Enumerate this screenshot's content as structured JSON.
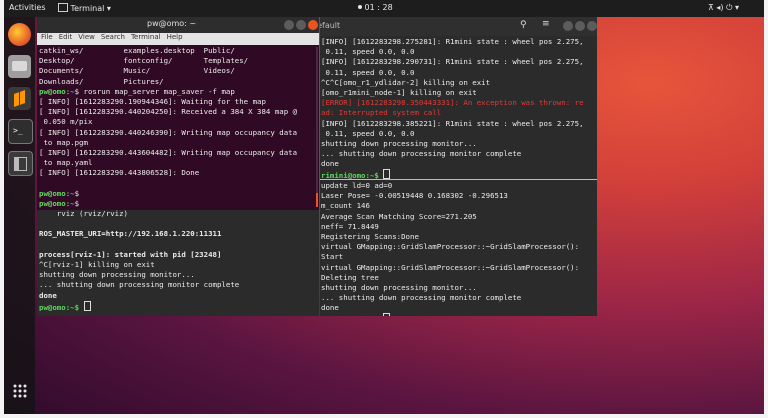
{
  "topbar": {
    "activities": "Activities",
    "app": "Terminal",
    "time": "01 : 28"
  },
  "window_left": {
    "title": "pw@omo: ~",
    "menu": [
      "File",
      "Edit",
      "View",
      "Search",
      "Terminal",
      "Help"
    ],
    "lines": [
      {
        "t": "catkin_ws/         examples.desktop  Public/",
        "c": "w"
      },
      {
        "t": "Desktop/           fontconfig/       Templates/",
        "c": "w"
      },
      {
        "t": "Documents/         Music/            Videos/",
        "c": "w"
      },
      {
        "t": "Downloads/         Pictures/",
        "c": "w"
      },
      {
        "t": "pw@omo:~$ rosrun map_server map_saver -f map",
        "c": "w"
      },
      {
        "t": "[ INFO] [1612283290.190944346]: Waiting for the map",
        "c": "w"
      },
      {
        "t": "[ INFO] [1612283290.440204250]: Received a 384 X 384 map @",
        "c": "w"
      },
      {
        "t": " 0.050 m/pix",
        "c": "w"
      },
      {
        "t": "[ INFO] [1612283290.440246390]: Writing map occupancy data",
        "c": "w"
      },
      {
        "t": " to map.pgm",
        "c": "w"
      },
      {
        "t": "[ INFO] [1612283290.443604482]: Writing map occupancy data",
        "c": "w"
      },
      {
        "t": " to map.yaml",
        "c": "w"
      },
      {
        "t": "[ INFO] [1612283290.443806528]: Done",
        "c": "w"
      },
      {
        "t": "",
        "c": "w"
      },
      {
        "t": "pw@omo:~$",
        "c": "w"
      },
      {
        "t": "pw@omo:~$",
        "c": "w"
      },
      {
        "t": "pw@omo:~$",
        "c": "w"
      },
      {
        "t": "pw@omo:~$",
        "c": "w"
      }
    ],
    "prompt_user": "pw@omo"
  },
  "window_bottom_left": {
    "lines": [
      {
        "t": "    rviz (rviz/rviz)",
        "c": "w",
        "bold": false
      },
      {
        "t": "",
        "c": "w",
        "bold": false
      },
      {
        "t": "ROS_MASTER_URI=http://192.168.1.220:11311",
        "c": "w",
        "bold": true
      },
      {
        "t": "",
        "c": "w",
        "bold": false
      },
      {
        "t": "process[rviz-1]: started with pid [23248]",
        "c": "w",
        "bold": true
      },
      {
        "t": "^C[rviz-1] killing on exit",
        "c": "w",
        "bold": false
      },
      {
        "t": "shutting down processing monitor...",
        "c": "w",
        "bold": false
      },
      {
        "t": "... shutting down processing monitor complete",
        "c": "w",
        "bold": false
      },
      {
        "t": "done",
        "c": "w",
        "bold": true
      },
      {
        "t": "pw@omo:~$ ",
        "c": "g",
        "bold": true
      }
    ]
  },
  "window_right": {
    "title": "default",
    "top_lines": [
      {
        "t": "[INFO] [1612283298.275281]: R1mini state : wheel pos 2.275,",
        "c": "w"
      },
      {
        "t": " 0.11, speed 0.0, 0.0",
        "c": "w"
      },
      {
        "t": "[INFO] [1612283298.290731]: R1mini state : wheel pos 2.275,",
        "c": "w"
      },
      {
        "t": " 0.11, speed 0.0, 0.0",
        "c": "w"
      },
      {
        "t": "^C^C[omo_r1_ydlidar-2] killing on exit",
        "c": "w"
      },
      {
        "t": "[omo_r1mini_node-1] killing on exit",
        "c": "w"
      },
      {
        "t": "[ERROR] [1612283298.350443331]: An exception was thrown: re",
        "c": "r"
      },
      {
        "t": "ad: Interrupted system call",
        "c": "r"
      },
      {
        "t": "[INFO] [1612283298.385221]: R1mini state : wheel pos 2.275,",
        "c": "w"
      },
      {
        "t": " 0.11, speed 0.0, 0.0",
        "c": "w"
      },
      {
        "t": "shutting down processing monitor...",
        "c": "w"
      },
      {
        "t": "... shutting down processing monitor complete",
        "c": "w"
      },
      {
        "t": "done",
        "c": "w"
      },
      {
        "t": "rimini@omo:~$ ",
        "c": "g"
      }
    ],
    "bottom_lines": [
      {
        "t": "update ld=0 ad=0",
        "c": "w"
      },
      {
        "t": "Laser Pose= -0.00519448 0.168302 -0.296513",
        "c": "w"
      },
      {
        "t": "m_count 146",
        "c": "w"
      },
      {
        "t": "Average Scan Matching Score=271.205",
        "c": "w"
      },
      {
        "t": "neff= 71.8449",
        "c": "w"
      },
      {
        "t": "Registering Scans:Done",
        "c": "w"
      },
      {
        "t": "virtual GMapping::GridSlamProcessor::~GridSlamProcessor():",
        "c": "w"
      },
      {
        "t": "Start",
        "c": "w"
      },
      {
        "t": "virtual GMapping::GridSlamProcessor::~GridSlamProcessor():",
        "c": "w"
      },
      {
        "t": "Deleting tree",
        "c": "w"
      },
      {
        "t": "shutting down processing monitor...",
        "c": "w"
      },
      {
        "t": "... shutting down processing monitor complete",
        "c": "w"
      },
      {
        "t": "done",
        "c": "w"
      },
      {
        "t": "rimini@omo:~$ ",
        "c": "g"
      }
    ]
  },
  "dock": {
    "items": [
      {
        "name": "firefox-icon",
        "color": "#e8622c"
      },
      {
        "name": "files-icon",
        "color": "#9e9e9e"
      },
      {
        "name": "sublime-text-icon",
        "color": "#ff9800"
      },
      {
        "name": "terminal-icon",
        "color": "#2e2e2e"
      },
      {
        "name": "terminator-icon",
        "color": "#3a3a3a"
      }
    ],
    "apps_grid": "show-applications-icon"
  }
}
